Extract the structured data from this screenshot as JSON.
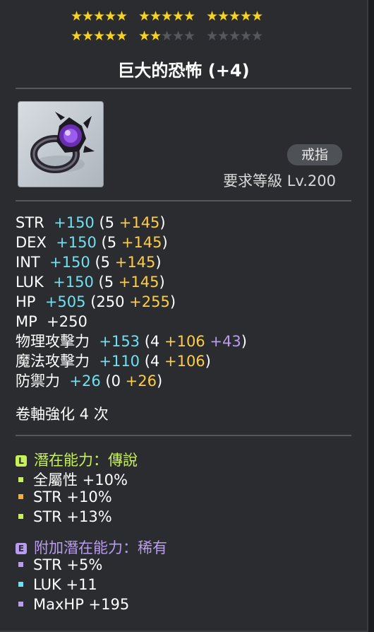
{
  "stars": {
    "rows": [
      [
        1,
        1,
        1,
        1,
        1,
        1,
        1,
        1,
        1,
        1,
        1,
        1,
        1,
        1,
        1
      ],
      [
        1,
        1,
        1,
        1,
        1,
        1,
        1,
        0,
        0,
        0,
        0,
        0,
        0,
        0,
        0
      ]
    ]
  },
  "item": {
    "title": "巨大的恐怖 (+4)",
    "icon": "ring-icon",
    "category": "戒指",
    "requirement": "要求等級 Lv.200"
  },
  "stats": [
    {
      "name": "STR",
      "total": "+150",
      "base": "5",
      "scroll": "+145",
      "extra": ""
    },
    {
      "name": "DEX",
      "total": "+150",
      "base": "5",
      "scroll": "+145",
      "extra": ""
    },
    {
      "name": "INT",
      "total": "+150",
      "base": "5",
      "scroll": "+145",
      "extra": ""
    },
    {
      "name": "LUK",
      "total": "+150",
      "base": "5",
      "scroll": "+145",
      "extra": ""
    },
    {
      "name": "HP",
      "total": "+505",
      "base": "250",
      "scroll": "+255",
      "extra": ""
    },
    {
      "name": "MP",
      "total": "+250",
      "base": "",
      "scroll": "",
      "extra": ""
    },
    {
      "name": "物理攻擊力",
      "total": "+153",
      "base": "4",
      "scroll": "+106",
      "extra": "+43"
    },
    {
      "name": "魔法攻擊力",
      "total": "+110",
      "base": "4",
      "scroll": "+106",
      "extra": ""
    },
    {
      "name": "防禦力",
      "total": "+26",
      "base": "0",
      "scroll": "+26",
      "extra": ""
    }
  ],
  "scroll_info": "卷軸強化 4 次",
  "potential": {
    "badge": "L",
    "label": "潛在能力：傳說",
    "color": "#c8f05a",
    "lines": [
      {
        "text": "全屬性 +10%",
        "dot": "#c8f05a"
      },
      {
        "text": "STR +10%",
        "dot": "#f0b040"
      },
      {
        "text": "STR +13%",
        "dot": "#c8f05a"
      }
    ]
  },
  "additional": {
    "badge": "E",
    "label": "附加潛在能力：稀有",
    "color": "#b99bf0",
    "lines": [
      {
        "text": "STR +5%",
        "dot": "#b99bf0"
      },
      {
        "text": "LUK +11",
        "dot": "#6fe0f0"
      },
      {
        "text": "MaxHP +195",
        "dot": "#b99bf0"
      }
    ]
  }
}
